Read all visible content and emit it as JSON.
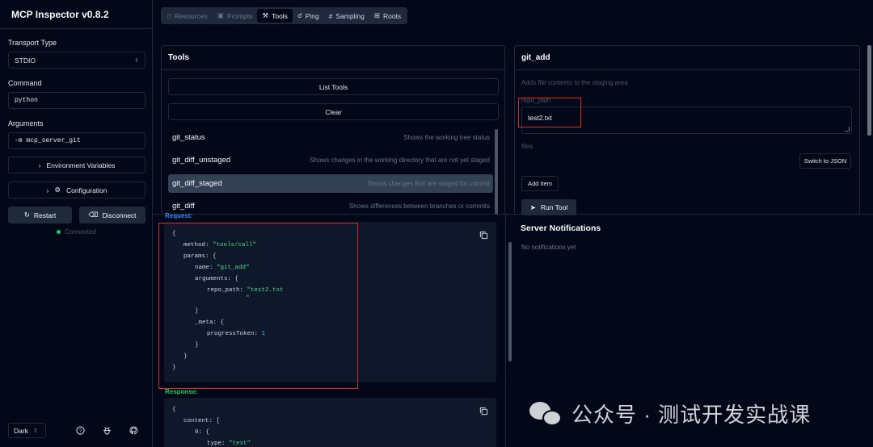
{
  "app": {
    "title": "MCP Inspector v0.8.2"
  },
  "sidebar": {
    "transport_label": "Transport Type",
    "transport_value": "STDIO",
    "command_label": "Command",
    "command_value": "python",
    "arguments_label": "Arguments",
    "arguments_value": "-m mcp_server_git",
    "env_button": "Environment Variables",
    "config_button": "Configuration",
    "restart_button": "Restart",
    "disconnect_button": "Disconnect",
    "status": "Connected",
    "theme": "Dark"
  },
  "tabs": [
    {
      "label": "Resources",
      "icon": "file-icon"
    },
    {
      "label": "Prompts",
      "icon": "message-icon"
    },
    {
      "label": "Tools",
      "icon": "wrench-icon"
    },
    {
      "label": "Ping",
      "icon": "bell-icon"
    },
    {
      "label": "Sampling",
      "icon": "hash-icon"
    },
    {
      "label": "Roots",
      "icon": "folder-tree-icon"
    }
  ],
  "active_tab": "Tools",
  "tools_panel": {
    "title": "Tools",
    "list_button": "List Tools",
    "clear_button": "Clear",
    "items": [
      {
        "name": "git_status",
        "description": "Shows the working tree status"
      },
      {
        "name": "git_diff_unstaged",
        "description": "Shows changes in the working directory that are not yet staged"
      },
      {
        "name": "git_diff_staged",
        "description": "Shows changes that are staged for commit"
      },
      {
        "name": "git_diff",
        "description": "Shows differences between branches or commits"
      }
    ],
    "selected_index": 2
  },
  "tool_detail": {
    "title": "git_add",
    "description": "Adds file contents to the staging area",
    "param1_label": "repo_path",
    "param1_value": "test2.txt",
    "param2_label": "files",
    "switch_json_button": "Switch to JSON",
    "add_item_button": "Add Item",
    "run_button": "Run Tool"
  },
  "request": {
    "label": "Request:",
    "lines": [
      "{",
      "method: \"tools/call\"",
      "params: {",
      "name: \"git_add\"",
      "arguments: {",
      "repo_path: \"test2.txt",
      "\"",
      "}",
      "_meta: {",
      "progressToken: 1",
      "}",
      "}",
      "}"
    ]
  },
  "response": {
    "label": "Response:",
    "lines": [
      "{",
      "content: [",
      "0: {",
      "type: \"text\""
    ]
  },
  "notifications": {
    "title": "Server Notifications",
    "empty": "No notifications yet"
  },
  "watermark": "公众号 · 测试开发实战课",
  "colors": {
    "background": "#020817",
    "border": "#1e293b",
    "request_label": "#3b82f6",
    "response_label": "#22c55e",
    "highlight": "#dc2626",
    "string": "#4ade80",
    "number": "#60a5fa"
  }
}
